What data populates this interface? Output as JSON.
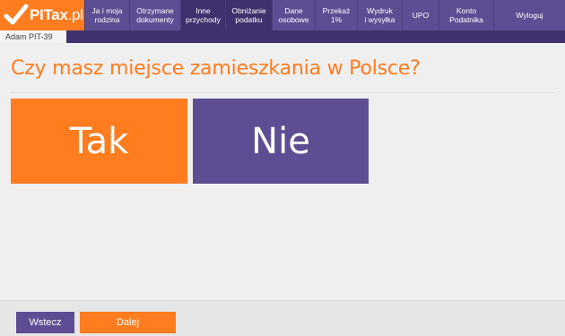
{
  "logo": {
    "text_bold": "PITax",
    "text_light": ".pl",
    "icon": "checkmark-icon"
  },
  "nav": {
    "items": [
      {
        "label": "Ja i moja\nrodzina",
        "active": false
      },
      {
        "label": "Otrzymane\ndokumenty",
        "active": false
      },
      {
        "label": "Inne\nprzychody",
        "active": true
      },
      {
        "label": "Obniżanie\npodatku",
        "active": true
      },
      {
        "label": "Dane\nosobowe",
        "active": false
      },
      {
        "label": "Przekaż\n1%",
        "active": false
      },
      {
        "label": "Wydruk\ni wysyłka",
        "active": false
      },
      {
        "label": "UPO",
        "active": false
      },
      {
        "label": "Konto\nPodatnika",
        "active": false
      },
      {
        "label": "Wyloguj",
        "active": false
      }
    ]
  },
  "tab": {
    "label": "Adam PIT-39"
  },
  "question": {
    "title": "Czy masz miejsce zamieszkania w Polsce?"
  },
  "choices": {
    "yes": "Tak",
    "no": "Nie"
  },
  "footer": {
    "back_label": "Wstecz",
    "next_label": "Dalej"
  },
  "colors": {
    "orange": "#ff7c1f",
    "purple": "#5d4e93",
    "dark_purple": "#3f316e"
  }
}
